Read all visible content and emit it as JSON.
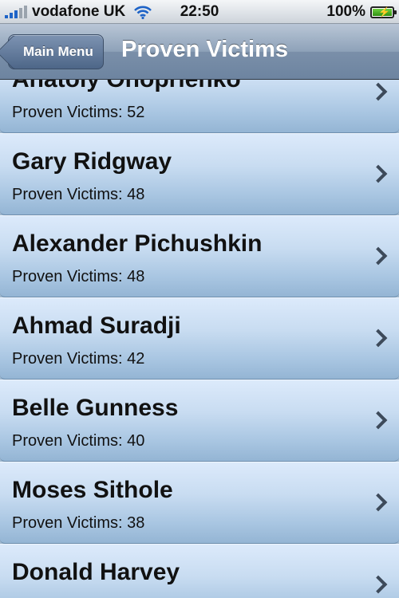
{
  "status_bar": {
    "carrier": "vodafone UK",
    "time": "22:50",
    "battery": "100%",
    "signal_icon": "signal-bars-icon",
    "wifi_icon": "wifi-icon",
    "battery_icon": "battery-charging-icon"
  },
  "nav": {
    "back_label": "Main Menu",
    "title": "Proven Victims"
  },
  "list": {
    "items": [
      {
        "name": "Anatoly Onoprienko",
        "detail": "Proven Victims: 52"
      },
      {
        "name": "Gary Ridgway",
        "detail": "Proven Victims: 48"
      },
      {
        "name": "Alexander Pichushkin",
        "detail": "Proven Victims: 48"
      },
      {
        "name": "Ahmad Suradji",
        "detail": "Proven Victims: 42"
      },
      {
        "name": "Belle Gunness",
        "detail": "Proven Victims: 40"
      },
      {
        "name": "Moses Sithole",
        "detail": "Proven Victims: 38"
      },
      {
        "name": "Donald Harvey",
        "detail": ""
      }
    ]
  },
  "colors": {
    "nav_bar": "#8ea2b9",
    "row_top": "#dceafb",
    "row_bottom": "#94b5d4",
    "signal": "#1e63c7",
    "battery": "#3aa01c"
  }
}
